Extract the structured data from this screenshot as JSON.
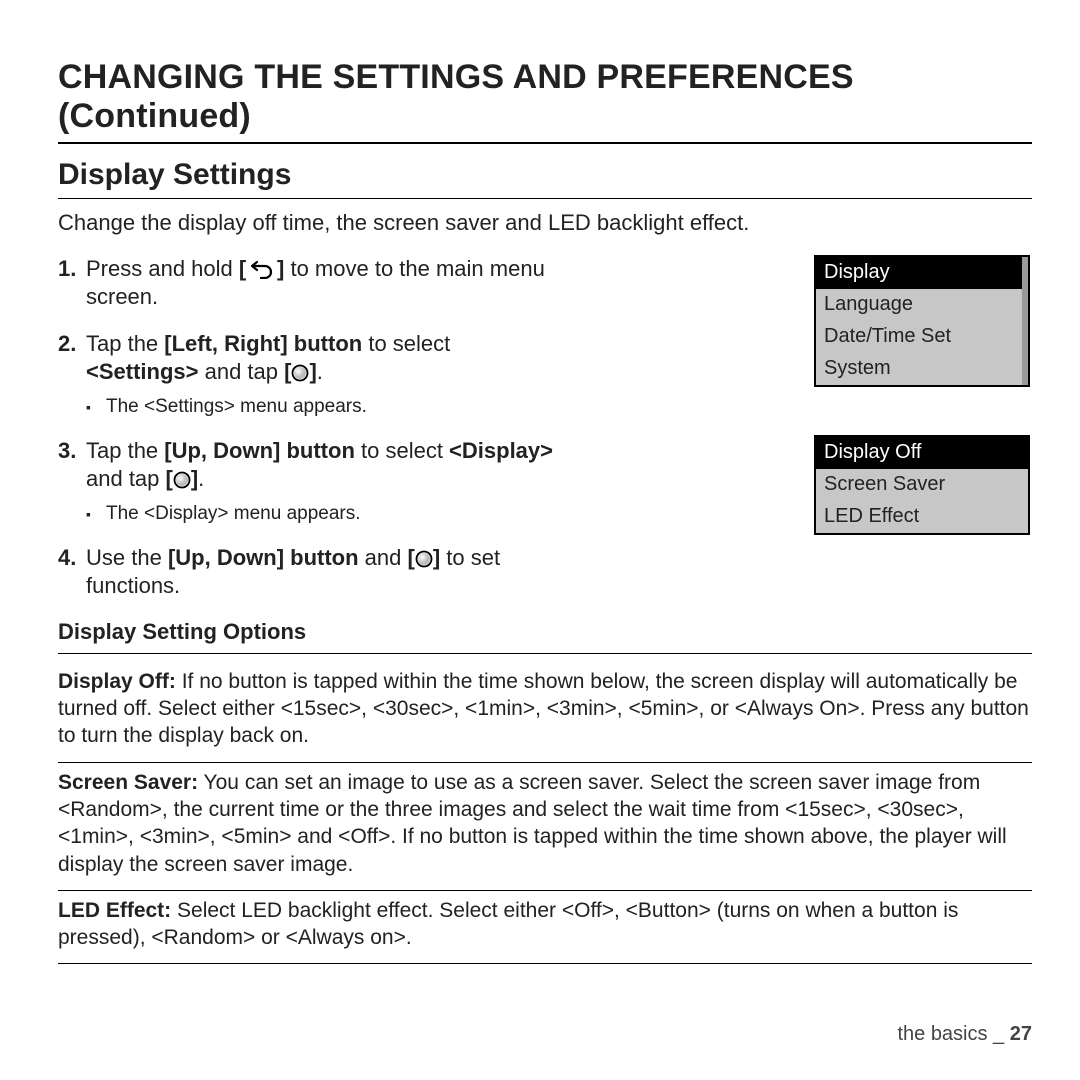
{
  "chapter_title": "CHANGING THE SETTINGS AND PREFERENCES (Continued)",
  "section_title": "Display Settings",
  "intro": "Change the display off time, the screen saver and LED backlight effect.",
  "steps": {
    "s1": {
      "num": "1.",
      "pre": "Press and hold ",
      "lb": "[",
      "rb": "]",
      "post": " to move to the main menu screen."
    },
    "s2": {
      "num": "2.",
      "pre": "Tap the ",
      "bold1": "[Left, Right] button",
      "mid": " to select ",
      "bold2": "<Settings>",
      "mid2": " and tap ",
      "lb": "[",
      "rb": "]",
      "end": ".",
      "sub": "The <Settings> menu appears."
    },
    "s3": {
      "num": "3.",
      "pre": "Tap the ",
      "bold1": "[Up, Down] button",
      "mid": " to select ",
      "bold2": "<Display>",
      "mid2": " and tap ",
      "lb": "[",
      "rb": "]",
      "end": ".",
      "sub": "The <Display> menu appears."
    },
    "s4": {
      "num": "4.",
      "pre": "Use the ",
      "bold1": "[Up, Down] button",
      "mid": " and ",
      "lb": "[",
      "rb": "]",
      "post": " to set functions."
    }
  },
  "menu1": {
    "r0": "Display",
    "r1": "Language",
    "r2": "Date/Time Set",
    "r3": "System"
  },
  "menu2": {
    "r0": "Display Off",
    "r1": "Screen Saver",
    "r2": "LED Effect"
  },
  "options_title": "Display Setting Options",
  "opt1": {
    "label": "Display Off:",
    "text": " If no button is tapped within the time shown below, the screen display will automatically be turned off. Select either <15sec>, <30sec>, <1min>, <3min>, <5min>, or <Always On>. Press any button to turn the display back on."
  },
  "opt2": {
    "label": "Screen Saver:",
    "text": " You can set an image to use as a screen saver. Select the screen saver image from <Random>, the current time or the three images and select the wait time from <15sec>, <30sec>, <1min>, <3min>, <5min> and <Off>. If no button is tapped within the time shown above, the player will display the screen saver image."
  },
  "opt3": {
    "label": "LED Effect:",
    "text": " Select LED backlight effect. Select either <Off>, <Button> (turns on when a button is pressed), <Random> or <Always on>."
  },
  "footer": {
    "section": "the basics _ ",
    "page": "27"
  }
}
